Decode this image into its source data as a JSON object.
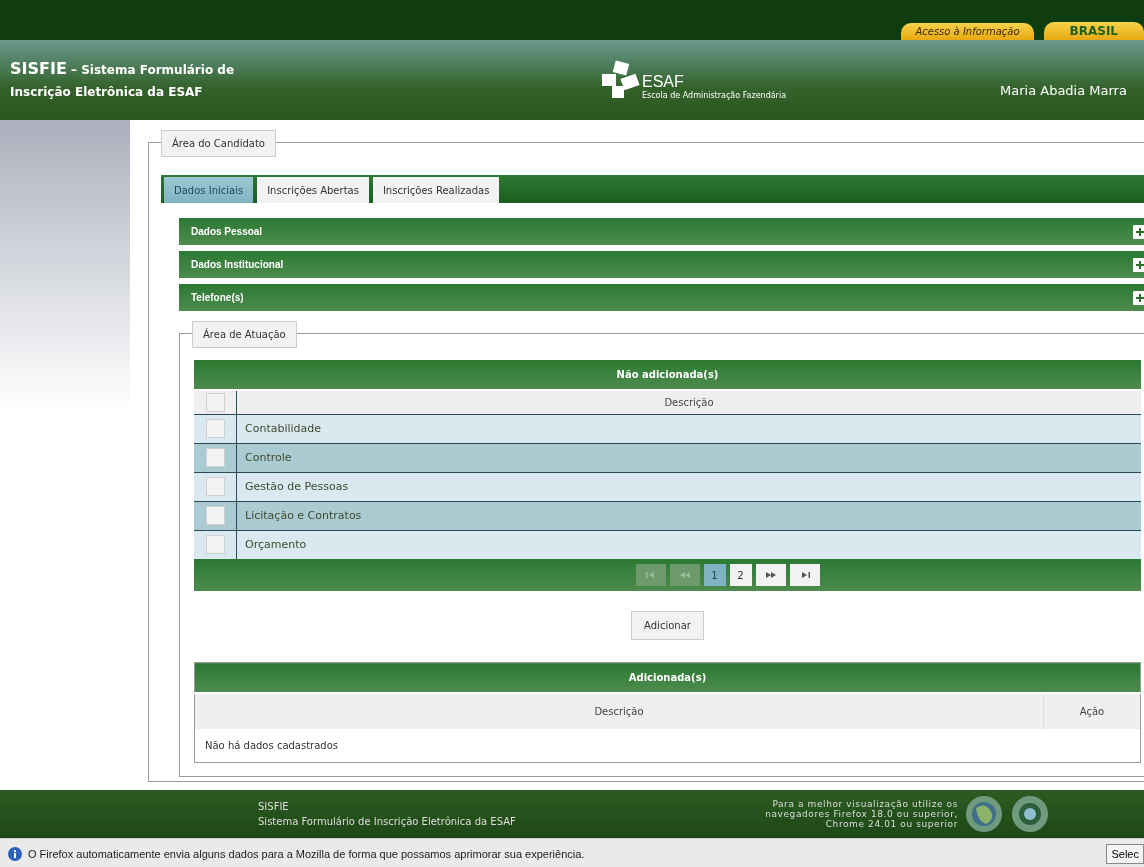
{
  "top_bar": {
    "links": [
      "Acesso à Informação",
      "BRASIL"
    ]
  },
  "header": {
    "title": "SISFIE",
    "title_rest": "– Sistema Formulário de",
    "subtitle": "Inscrição Eletrônica da ESAF",
    "logo_text": "ESAF",
    "logo_caption": "Escola de Administração Fazendária",
    "user": "Maria Abadia Marra"
  },
  "candidate_panel": {
    "legend": "Área do Candidato",
    "tabs": [
      {
        "label": "Dados Iniciais",
        "selected": true
      },
      {
        "label": "Inscrições Abertas",
        "selected": false
      },
      {
        "label": "Inscrições Realizadas",
        "selected": false
      }
    ],
    "sections": [
      {
        "title": "Dados Pessoal",
        "expanded": false
      },
      {
        "title": "Dados Institucional",
        "expanded": false
      },
      {
        "title": "Telefone(s)",
        "expanded": false
      }
    ],
    "area": {
      "legend": "Área de Atuação",
      "available": {
        "title": "Não adicionada(s)",
        "select_all_checked": false,
        "columns": [
          "Descrição"
        ],
        "rows": [
          {
            "description": "Contabilidade",
            "checked": false
          },
          {
            "description": "Controle",
            "checked": false
          },
          {
            "description": "Gestão de Pessoas",
            "checked": false
          },
          {
            "description": "Licitação e Contratos",
            "checked": false
          },
          {
            "description": "Orçamento",
            "checked": false
          }
        ],
        "pager": [
          {
            "kind": "first",
            "disabled": true
          },
          {
            "kind": "prev",
            "disabled": true
          },
          {
            "kind": "page",
            "label": "1",
            "selected": true
          },
          {
            "kind": "page",
            "label": "2",
            "selected": false
          },
          {
            "kind": "next",
            "disabled": false
          },
          {
            "kind": "last",
            "disabled": false
          }
        ]
      },
      "add_button": "Adicionar",
      "added": {
        "title": "Adicionada(s)",
        "columns": [
          "Descrição",
          "Ação"
        ],
        "empty_message": "Não há dados cadastrados"
      }
    }
  },
  "footer": {
    "app_name": "SISFIE",
    "app_full_name": "Sistema Formulário de Inscrição Eletrônica da ESAF",
    "browser_note": "Para a melhor visualização utilize os\nnavegadores Firefox 18.0 ou superior,\nChrome 24.01 ou superior"
  },
  "notification_bar": {
    "message": "O Firefox automaticamente envia alguns dados para a Mozilla de forma que possamos aprimorar sua experiência.",
    "button": "Selec"
  }
}
